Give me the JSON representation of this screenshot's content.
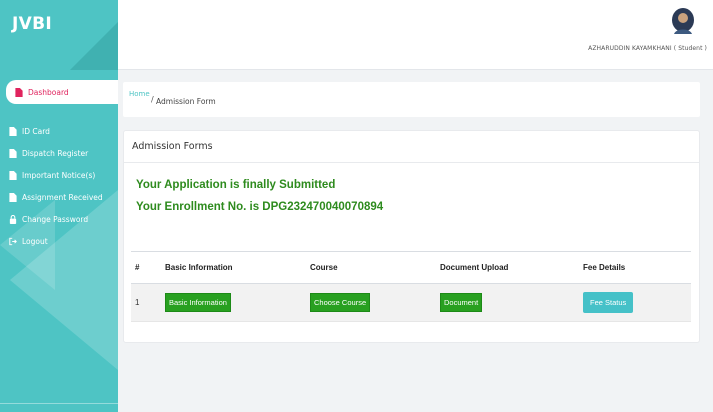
{
  "brand": {
    "name": "JVBI"
  },
  "sidebar": {
    "items": [
      {
        "label": "Dashboard",
        "icon": "file-icon"
      },
      {
        "label": "ID Card",
        "icon": "file-icon"
      },
      {
        "label": "Dispatch Register",
        "icon": "file-icon"
      },
      {
        "label": "Important Notice(s)",
        "icon": "file-icon"
      },
      {
        "label": "Assignment Received",
        "icon": "file-icon"
      },
      {
        "label": "Change Password",
        "icon": "lock-icon"
      },
      {
        "label": "Logout",
        "icon": "logout-icon"
      }
    ]
  },
  "header": {
    "user": "AZHARUDDIN KAYAMKHANI ( Student )"
  },
  "breadcrumb": {
    "home": "Home",
    "separator": "/",
    "current": "Admission Form"
  },
  "card": {
    "title": "Admission Forms",
    "message_line1": "Your Application is finally Submitted",
    "message_line2": "Your Enrollment No. is DPG232470040070894"
  },
  "table": {
    "headers": [
      "#",
      "Basic Information",
      "Course",
      "Document Upload",
      "Fee Details"
    ],
    "row": {
      "index": "1",
      "basic_info_button": "Basic Information",
      "course_button": "Choose Course",
      "document_button": "Document",
      "fee_button": "Fee Status"
    }
  },
  "colors": {
    "sidebar": "#4ec4c4",
    "active_text": "#e0245e",
    "success_text": "#2e8b1e",
    "green_button": "#28a020",
    "teal_button": "#45c1c8"
  }
}
